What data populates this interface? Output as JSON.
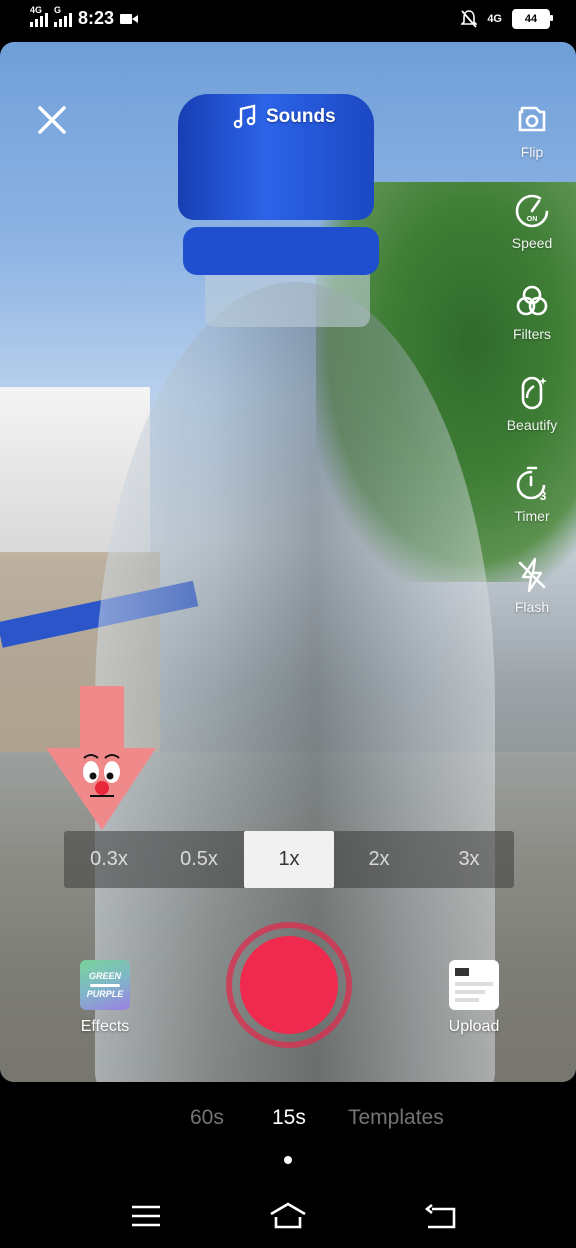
{
  "status": {
    "network1": "4G",
    "network2": "G",
    "time": "8:23",
    "network_right": "4G",
    "battery": "44"
  },
  "camera": {
    "sounds_label": "Sounds",
    "tools": [
      {
        "label": "Flip",
        "icon": "flip-camera-icon"
      },
      {
        "label": "Speed",
        "icon": "speed-icon"
      },
      {
        "label": "Filters",
        "icon": "filters-icon"
      },
      {
        "label": "Beautify",
        "icon": "beautify-icon"
      },
      {
        "label": "Timer",
        "icon": "timer-icon"
      },
      {
        "label": "Flash",
        "icon": "flash-off-icon"
      }
    ],
    "speeds": [
      "0.3x",
      "0.5x",
      "1x",
      "2x",
      "3x"
    ],
    "selected_speed": "1x",
    "effects_label": "Effects",
    "effects_thumb_line1": "GREEN",
    "effects_thumb_line2": "PURPLE",
    "upload_label": "Upload"
  },
  "modes": {
    "items": [
      "60s",
      "15s",
      "Templates"
    ],
    "selected": "15s"
  },
  "colors": {
    "record": "#f0294f",
    "sticker": "#f08a8a"
  }
}
